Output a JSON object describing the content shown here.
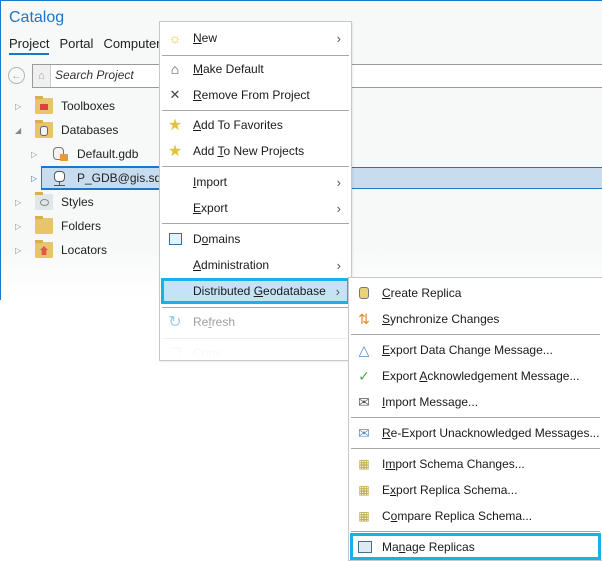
{
  "pane": {
    "title": "Catalog",
    "tabs": [
      {
        "label": "Project",
        "active": true
      },
      {
        "label": "Portal",
        "active": false
      },
      {
        "label": "Computer",
        "active": false
      }
    ],
    "search_placeholder": "Search Project",
    "tree": [
      {
        "label": "Toolboxes",
        "icon": "toolbox-icon",
        "expanded": false,
        "level": 0
      },
      {
        "label": "Databases",
        "icon": "databases-folder-icon",
        "expanded": true,
        "level": 0
      },
      {
        "label": "Default.gdb",
        "icon": "default-geodatabase-icon",
        "expanded": false,
        "level": 1
      },
      {
        "label": "P_GDB@gis.sde",
        "icon": "database-connection-icon",
        "expanded": false,
        "level": 1,
        "selected": true
      },
      {
        "label": "Styles",
        "icon": "styles-folder-icon",
        "expanded": false,
        "level": 0
      },
      {
        "label": "Folders",
        "icon": "folders-icon",
        "expanded": false,
        "level": 0
      },
      {
        "label": "Locators",
        "icon": "locators-folder-icon",
        "expanded": false,
        "level": 0
      }
    ]
  },
  "context_menu": {
    "items": [
      {
        "label": "New",
        "mnemonic": "N",
        "icon": "new-sun-icon",
        "submenu": true
      },
      {
        "label": "Make Default",
        "mnemonic": "M",
        "icon": "home-icon",
        "submenu": false
      },
      {
        "label": "Remove From Project",
        "mnemonic": "R",
        "icon": "remove-x-icon",
        "submenu": false
      },
      {
        "label": "Add To Favorites",
        "mnemonic": "A",
        "icon": "star-icon",
        "submenu": false
      },
      {
        "label": "Add To New Projects",
        "mnemonic": "T",
        "icon": "star-pin-icon",
        "submenu": false
      },
      {
        "label": "Import",
        "mnemonic": "I",
        "icon": "",
        "submenu": true
      },
      {
        "label": "Export",
        "mnemonic": "E",
        "icon": "",
        "submenu": true
      },
      {
        "label": "Domains",
        "mnemonic": "o",
        "icon": "domains-icon",
        "submenu": false
      },
      {
        "label": "Administration",
        "mnemonic": "A",
        "icon": "",
        "submenu": true
      },
      {
        "label": "Distributed Geodatabase",
        "mnemonic": "G",
        "icon": "",
        "submenu": true,
        "highlighted": true
      },
      {
        "label": "Refresh",
        "mnemonic": "f",
        "icon": "refresh-icon",
        "submenu": false,
        "disabled": true
      },
      {
        "label": "Copy",
        "mnemonic": "",
        "icon": "copy-icon",
        "submenu": false,
        "disabled": true
      }
    ]
  },
  "submenu": {
    "items": [
      {
        "label": "Create Replica",
        "mnemonic": "C",
        "icon": "create-replica-icon"
      },
      {
        "label": "Synchronize Changes",
        "mnemonic": "S",
        "icon": "synchronize-changes-icon"
      },
      {
        "label": "Export Data Change Message...",
        "mnemonic": "E",
        "icon": "export-data-change-icon"
      },
      {
        "label": "Export Acknowledgement Message...",
        "mnemonic": "A",
        "icon": "export-acknowledgement-icon"
      },
      {
        "label": "Import Message...",
        "mnemonic": "I",
        "icon": "import-message-icon"
      },
      {
        "label": "Re-Export Unacknowledged Messages...",
        "mnemonic": "R",
        "icon": "re-export-messages-icon"
      },
      {
        "label": "Import Schema Changes...",
        "mnemonic": "m",
        "icon": "import-schema-icon"
      },
      {
        "label": "Export Replica Schema...",
        "mnemonic": "x",
        "icon": "export-schema-icon"
      },
      {
        "label": "Compare Replica Schema...",
        "mnemonic": "o",
        "icon": "compare-schema-icon"
      },
      {
        "label": "Manage Replicas",
        "mnemonic": "n",
        "icon": "manage-replicas-icon",
        "boxed": true
      }
    ]
  },
  "colors": {
    "accent": "#1b78c8",
    "highlight_outline": "#1ab0e8",
    "highlight_fill": "#c5e3f6",
    "selection_fill": "#c7dcef"
  }
}
